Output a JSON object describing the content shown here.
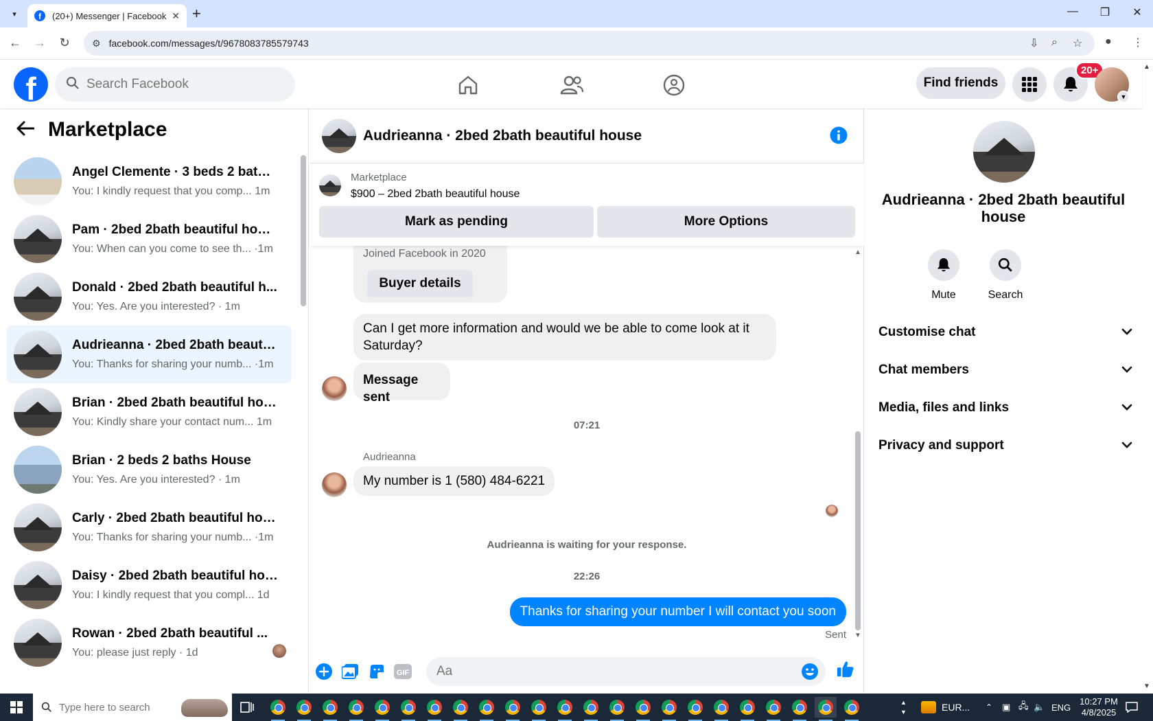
{
  "browser": {
    "tab_title": "(20+) Messenger | Facebook",
    "url": "facebook.com/messages/t/9678083785579743"
  },
  "header": {
    "search_placeholder": "Search Facebook",
    "find_friends_label": "Find friends",
    "notification_badge": "20+"
  },
  "sidebar": {
    "title": "Marketplace",
    "conversations": [
      {
        "name": "Angel Clemente · 3 beds 2 baths ...",
        "snippet": "You: I kindly request that you comp... 1m",
        "thumb": "house-light"
      },
      {
        "name": "Pam · 2bed 2bath beautiful house",
        "snippet": "You: When can you come to see th... ·1m",
        "thumb": "house-dark"
      },
      {
        "name": "Donald · 2bed 2bath beautiful h...",
        "snippet": "You: Yes. Are you interested? · 1m",
        "thumb": "house-dark"
      },
      {
        "name": "Audrieanna · 2bed 2bath beautif...",
        "snippet": "You: Thanks for sharing your numb... ·1m",
        "thumb": "house-dark",
        "active": true
      },
      {
        "name": "Brian · 2bed 2bath beautiful house",
        "snippet": "You: Kindly share your contact num... 1m",
        "thumb": "house-dark"
      },
      {
        "name": "Brian · 2 beds 2 baths House",
        "snippet": "You: Yes. Are you interested? · 1m",
        "thumb": "house-blue"
      },
      {
        "name": "Carly · 2bed 2bath beautiful house",
        "snippet": "You: Thanks for sharing your numb... ·1m",
        "thumb": "house-dark"
      },
      {
        "name": "Daisy · 2bed 2bath beautiful hou...",
        "snippet": "You: I kindly request that you compl... 1d",
        "thumb": "house-dark"
      },
      {
        "name": "Rowan · 2bed 2bath beautiful ...",
        "snippet": "You: please just reply · 1d",
        "thumb": "house-dark"
      }
    ]
  },
  "chat": {
    "title": "Audrieanna · 2bed 2bath beautiful house",
    "marketplace_label": "Marketplace",
    "listing": "$900 – 2bed 2bath beautiful house",
    "mark_pending_label": "Mark as pending",
    "more_options_label": "More Options",
    "joined_text": "Joined Facebook in 2020",
    "buyer_details_label": "Buyer details",
    "msg_info_request": "Can I get more information and would we be able to come look at it Saturday?",
    "msg_sent_card": "Message sent",
    "time_1": "07:21",
    "sender_name": "Audrieanna",
    "msg_number": "My number is 1 (580) 484-6221",
    "waiting_text": "Audrieanna is waiting for your response.",
    "time_2": "22:26",
    "msg_reply": "Thanks for sharing your number I will contact you soon",
    "sent_status": "Sent",
    "composer_placeholder": "Aa"
  },
  "right_panel": {
    "name": "Audrieanna · 2bed 2bath beautiful house",
    "mute_label": "Mute",
    "search_label": "Search",
    "sections": [
      "Customise chat",
      "Chat members",
      "Media, files and links",
      "Privacy and support"
    ]
  },
  "taskbar": {
    "search_placeholder": "Type here to search",
    "weather": "EUR...",
    "lang": "ENG",
    "time": "10:27 PM",
    "date": "4/8/2025"
  },
  "colors": {
    "fb_blue": "#0866ff",
    "messenger_blue": "#0084ff",
    "active_row": "#ebf5ff",
    "badge_red": "#e41e3f"
  }
}
